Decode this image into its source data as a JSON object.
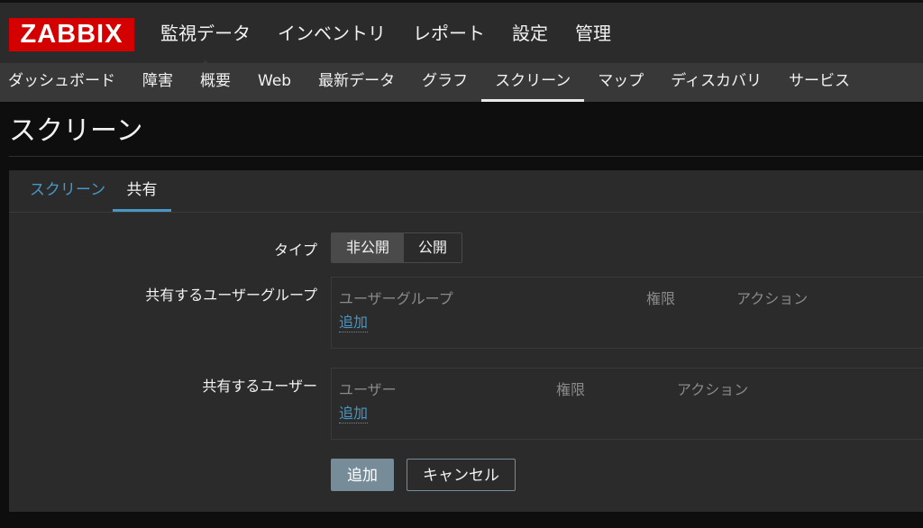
{
  "header": {
    "logo": "ZABBIX",
    "main_nav": [
      "監視データ",
      "インベントリ",
      "レポート",
      "設定",
      "管理"
    ],
    "main_nav_active": 0
  },
  "sub_nav": {
    "items": [
      "ダッシュボード",
      "障害",
      "概要",
      "Web",
      "最新データ",
      "グラフ",
      "スクリーン",
      "マップ",
      "ディスカバリ",
      "サービス"
    ],
    "active": 6
  },
  "page": {
    "title": "スクリーン"
  },
  "tabs": {
    "screen": "スクリーン",
    "sharing": "共有"
  },
  "form": {
    "type_label": "タイプ",
    "type_options": {
      "private": "非公開",
      "public": "公開"
    },
    "type_selected": "private",
    "user_groups": {
      "label": "共有するユーザーグループ",
      "col_group": "ユーザーグループ",
      "col_permission": "権限",
      "col_action": "アクション",
      "add_link": "追加"
    },
    "users": {
      "label": "共有するユーザー",
      "col_user": "ユーザー",
      "col_permission": "権限",
      "col_action": "アクション",
      "add_link": "追加"
    },
    "buttons": {
      "add": "追加",
      "cancel": "キャンセル"
    }
  },
  "colors": {
    "logo_red": "#d40000",
    "link_blue": "#4796c4",
    "primary_button": "#768d99",
    "panel_bg": "#2b2b2b",
    "subnav_bg": "#383838"
  }
}
